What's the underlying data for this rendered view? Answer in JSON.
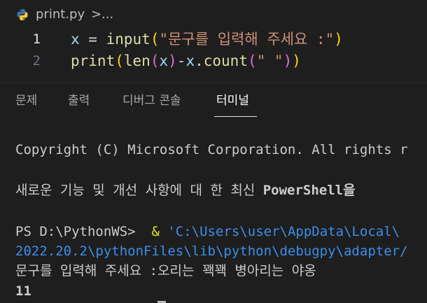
{
  "breadcrumb": {
    "file_icon": "python-icon",
    "filename": "print.py",
    "separator": ">",
    "more": "..."
  },
  "editor": {
    "lines": [
      {
        "number": "1",
        "tokens": {
          "var": "x",
          "assign": " = ",
          "fn": "input",
          "open": "(",
          "str": "\"문구를 입력해 주세요 :\"",
          "close": ")"
        }
      },
      {
        "number": "2",
        "tokens": {
          "fn1": "print",
          "open1": "(",
          "fn2": "len",
          "open2": "(",
          "arg": "x",
          "close2": ")",
          "minus": "-",
          "obj": "x",
          "dot": ".",
          "method": "count",
          "open3": "(",
          "str": "\" \"",
          "close3": ")",
          "close1": ")"
        }
      }
    ]
  },
  "panel": {
    "tabs": [
      "문제",
      "출력",
      "디버그 콘솔",
      "터미널"
    ],
    "active_tab": "터미널"
  },
  "terminal": {
    "copyright": "Copyright (C) Microsoft Corporation. All rights r",
    "powershell_notice_prefix": "새로운 기능 및 개선 사항에 대 한 최신 ",
    "powershell_notice_bold": "PowerShell을",
    "prompt": "PS D:\\PythonWS> ",
    "ampersand": " & ",
    "command_path_1": "'C:\\Users\\user\\AppData\\Local\\",
    "command_path_2": "2022.20.2\\pythonFiles\\lib\\python\\debugpy\\adapter/",
    "input_line": "문구를 입력해 주세요 :오리는 꽥꽥 병아리는 야옹",
    "output": "11"
  },
  "colors": {
    "background": "#1e1e1e",
    "keyword_fn": "#dcdcaa",
    "variable": "#9cdcfe",
    "string": "#ce9178",
    "bracket_level1": "#ffd700",
    "bracket_level2": "#da70d6",
    "terminal_yellow": "#e5e510",
    "terminal_blue": "#3b8eea"
  }
}
